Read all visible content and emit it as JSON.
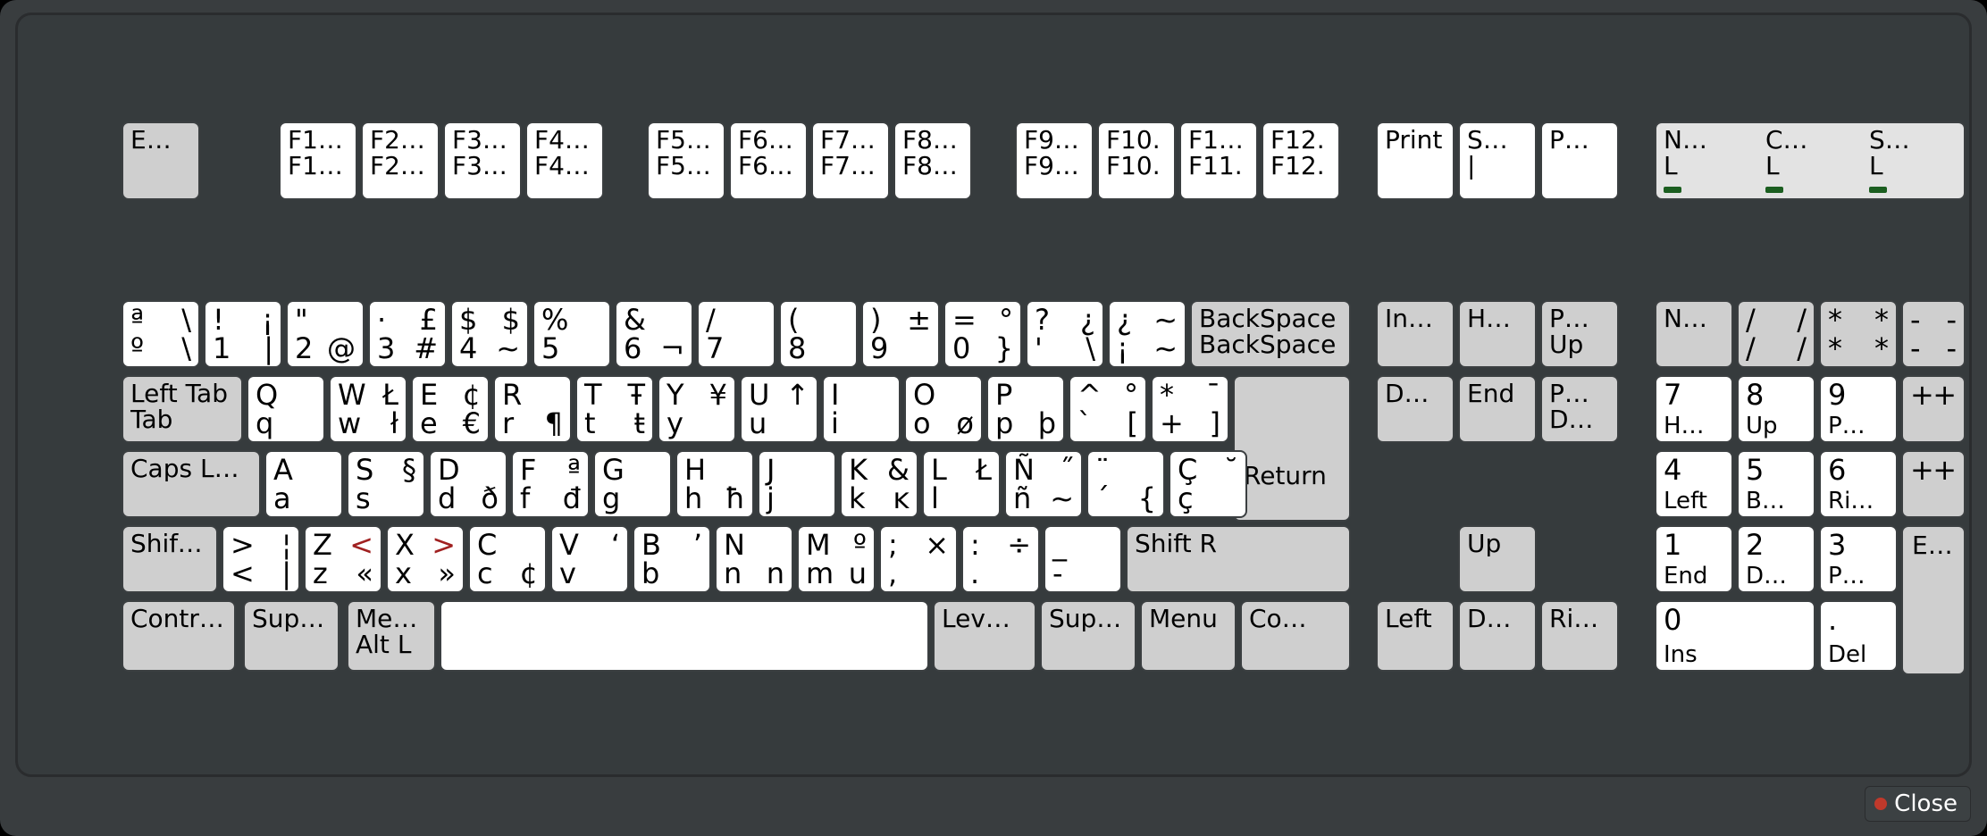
{
  "close_label": "Close",
  "fnrow": {
    "esc": {
      "top": "",
      "bot": "E…"
    },
    "f": [
      {
        "top": "F1…",
        "bot": "F1…"
      },
      {
        "top": "F2…",
        "bot": "F2…"
      },
      {
        "top": "F3…",
        "bot": "F3…"
      },
      {
        "top": "F4…",
        "bot": "F4…"
      },
      {
        "top": "F5…",
        "bot": "F5…"
      },
      {
        "top": "F6…",
        "bot": "F6…"
      },
      {
        "top": "F7…",
        "bot": "F7…"
      },
      {
        "top": "F8…",
        "bot": "F8…"
      },
      {
        "top": "F9…",
        "bot": "F9…"
      },
      {
        "top": "F10.",
        "bot": "F10."
      },
      {
        "top": "F11…",
        "bot": "F11."
      },
      {
        "top": "F12.",
        "bot": "F12."
      }
    ],
    "print": {
      "top": "",
      "bot": "Print"
    },
    "scroll": {
      "top": "S…",
      "bot": "|"
    },
    "pause": {
      "top": "",
      "bot": "P…"
    },
    "locks": [
      {
        "top": "N…",
        "bot": "L"
      },
      {
        "top": "C…",
        "bot": "L"
      },
      {
        "top": "S…",
        "bot": "L"
      }
    ]
  },
  "row1": [
    {
      "tl": "ª",
      "tr": "\\",
      "bl": "º",
      "br": "\\"
    },
    {
      "tl": "!",
      "tr": "¡",
      "bl": "1",
      "br": "|"
    },
    {
      "tl": "\"",
      "tr": "",
      "bl": "2",
      "br": "@"
    },
    {
      "tl": "·",
      "tr": "£",
      "bl": "3",
      "br": "#"
    },
    {
      "tl": "$",
      "tr": "$",
      "bl": "4",
      "br": "~"
    },
    {
      "tl": "%",
      "tr": "",
      "bl": "5",
      "br": ""
    },
    {
      "tl": "&",
      "tr": "",
      "bl": "6",
      "br": "¬"
    },
    {
      "tl": "/",
      "tr": "",
      "bl": "7",
      "br": ""
    },
    {
      "tl": "(",
      "tr": "",
      "bl": "8",
      "br": ""
    },
    {
      "tl": ")",
      "tr": "±",
      "bl": "9",
      "br": ""
    },
    {
      "tl": "=",
      "tr": "°",
      "bl": "0",
      "br": "}"
    },
    {
      "tl": "?",
      "tr": "¿",
      "bl": "'",
      "br": "\\"
    },
    {
      "tl": "¿",
      "tr": "~",
      "bl": "¡",
      "br": "~"
    }
  ],
  "backspace": {
    "top": "BackSpace",
    "bot": "BackSpace"
  },
  "row2_tab": {
    "top": "Left Tab",
    "bot": "Tab"
  },
  "row2": [
    {
      "tl": "Q",
      "tr": "",
      "bl": "q",
      "br": ""
    },
    {
      "tl": "W",
      "tr": "Ł",
      "bl": "w",
      "br": "ł"
    },
    {
      "tl": "E",
      "tr": "¢",
      "bl": "e",
      "br": "€"
    },
    {
      "tl": "R",
      "tr": "",
      "bl": "r",
      "br": "¶"
    },
    {
      "tl": "T",
      "tr": "Ŧ",
      "bl": "t",
      "br": "ŧ"
    },
    {
      "tl": "Y",
      "tr": "¥",
      "bl": "y",
      "br": ""
    },
    {
      "tl": "U",
      "tr": "↑",
      "bl": "u",
      "br": ""
    },
    {
      "tl": "I",
      "tr": "",
      "bl": "i",
      "br": ""
    },
    {
      "tl": "O",
      "tr": "",
      "bl": "o",
      "br": "ø"
    },
    {
      "tl": "P",
      "tr": "",
      "bl": "p",
      "br": "þ"
    },
    {
      "tl": "^",
      "tr": "°",
      "bl": "`",
      "br": "["
    },
    {
      "tl": "*",
      "tr": "¯",
      "bl": "+",
      "br": "]"
    }
  ],
  "return_label": "Return",
  "row3_caps": {
    "top": "",
    "bot": "Caps L…"
  },
  "row3": [
    {
      "tl": "A",
      "tr": "",
      "bl": "a",
      "br": ""
    },
    {
      "tl": "S",
      "tr": "§",
      "bl": "s",
      "br": ""
    },
    {
      "tl": "D",
      "tr": "",
      "bl": "d",
      "br": "ð"
    },
    {
      "tl": "F",
      "tr": "ª",
      "bl": "f",
      "br": "đ"
    },
    {
      "tl": "G",
      "tr": "",
      "bl": "g",
      "br": ""
    },
    {
      "tl": "H",
      "tr": "",
      "bl": "h",
      "br": "ħ"
    },
    {
      "tl": "J",
      "tr": "",
      "bl": "j",
      "br": ""
    },
    {
      "tl": "K",
      "tr": "&",
      "bl": "k",
      "br": "ĸ"
    },
    {
      "tl": "L",
      "tr": "Ł",
      "bl": "l",
      "br": ""
    },
    {
      "tl": "Ñ",
      "tr": "˝",
      "bl": "ñ",
      "br": "~"
    },
    {
      "tl": "¨",
      "tr": "",
      "bl": "´",
      "br": "{"
    },
    {
      "tl": "Ç",
      "tr": "˘",
      "bl": "ç",
      "br": ""
    }
  ],
  "row4_lshift": {
    "top": "",
    "bot": "Shift L"
  },
  "row4_ltgt": {
    "tl": ">",
    "tr": "¦",
    "bl": "<",
    "br": "|"
  },
  "row4": [
    {
      "tl": "Z",
      "tr": "<",
      "bl": "z",
      "br": "«",
      "tr_red": true
    },
    {
      "tl": "X",
      "tr": ">",
      "bl": "x",
      "br": "»",
      "tr_red": true
    },
    {
      "tl": "C",
      "tr": "",
      "bl": "c",
      "br": "¢"
    },
    {
      "tl": "V",
      "tr": "‘",
      "bl": "v",
      "br": ""
    },
    {
      "tl": "B",
      "tr": "’",
      "bl": "b",
      "br": ""
    },
    {
      "tl": "N",
      "tr": "",
      "bl": "n",
      "br": "n"
    },
    {
      "tl": "M",
      "tr": "º",
      "bl": "m",
      "br": "u"
    },
    {
      "tl": ";",
      "tr": "×",
      "bl": ",",
      "br": ""
    },
    {
      "tl": ":",
      "tr": "÷",
      "bl": ".",
      "br": ""
    },
    {
      "tl": "_",
      "tr": "",
      "bl": "-",
      "br": ""
    }
  ],
  "row4_rshift": {
    "top": "",
    "bot": "Shift R"
  },
  "row5": {
    "lctrl": {
      "top": "",
      "bot": "Contr…"
    },
    "lsuper": {
      "top": "",
      "bot": "Sup…"
    },
    "meta": {
      "top": "Met…",
      "bot": "Alt L"
    },
    "level": {
      "top": "",
      "bot": "Lev…"
    },
    "rsuper": {
      "top": "",
      "bot": "Sup…"
    },
    "menu": {
      "top": "",
      "bot": "Menu"
    },
    "rctrl": {
      "top": "",
      "bot": "Co…"
    }
  },
  "nav": {
    "ins": {
      "top": "",
      "bot": "In…"
    },
    "home": {
      "top": "",
      "bot": "H…"
    },
    "pgup": {
      "top": "P…",
      "bot": "Up"
    },
    "del": {
      "top": "",
      "bot": "D…"
    },
    "end": {
      "top": "",
      "bot": "End"
    },
    "pgdn": {
      "top": "P…",
      "bot": "D…"
    },
    "up": {
      "top": "",
      "bot": "Up"
    },
    "left": {
      "top": "",
      "bot": "Left"
    },
    "down": {
      "top": "",
      "bot": "D…"
    },
    "right": {
      "top": "",
      "bot": "Ri…"
    }
  },
  "numpad": {
    "numlock": {
      "top": "N…",
      "bot": ""
    },
    "div": {
      "tl": "/",
      "tr": "/",
      "bl": "/",
      "br": "/"
    },
    "mul": {
      "tl": "*",
      "tr": "*",
      "bl": "*",
      "br": "*"
    },
    "sub": {
      "tl": "-",
      "tr": "-",
      "bl": "-",
      "br": "-"
    },
    "add": {
      "tl": "+",
      "tr": "+",
      "bl": "",
      "br": ""
    },
    "add2": {
      "tl": "+",
      "tr": "+",
      "bl": "",
      "br": ""
    },
    "enter": {
      "top": "E…",
      "bot": ""
    },
    "kp7": {
      "tl": "7",
      "bl": "H…"
    },
    "kp8": {
      "tl": "8",
      "bl": "Up"
    },
    "kp9": {
      "tl": "9",
      "bl": "P…"
    },
    "kp4": {
      "tl": "4",
      "bl": "Left"
    },
    "kp5": {
      "tl": "5",
      "bl": "B…"
    },
    "kp6": {
      "tl": "6",
      "bl": "Ri…"
    },
    "kp1": {
      "tl": "1",
      "bl": "End"
    },
    "kp2": {
      "tl": "2",
      "bl": "D…"
    },
    "kp3": {
      "tl": "3",
      "bl": "P…"
    },
    "kp0": {
      "tl": "0",
      "bl": "Ins"
    },
    "kpdot": {
      "tl": ".",
      "bl": "Del"
    }
  }
}
